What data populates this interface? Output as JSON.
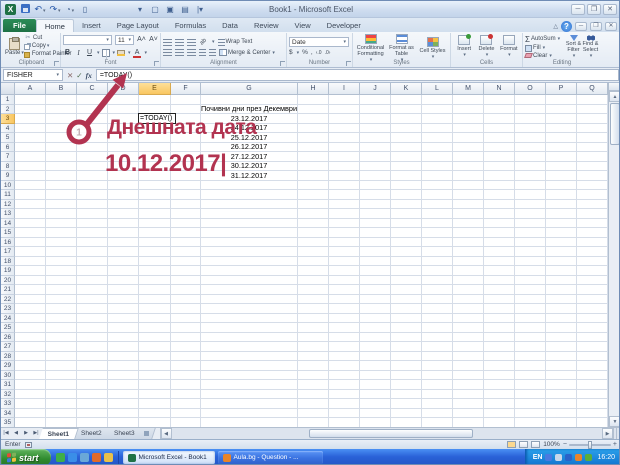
{
  "titlebar": {
    "title": "Book1 - Microsoft Excel"
  },
  "tabs": {
    "file": "File",
    "items": [
      "Home",
      "Insert",
      "Page Layout",
      "Formulas",
      "Data",
      "Review",
      "View",
      "Developer"
    ],
    "active": "Home"
  },
  "ribbon": {
    "clipboard": {
      "label": "Clipboard",
      "paste": "Paste",
      "cut": "Cut",
      "copy": "Copy",
      "format_painter": "Format Painter"
    },
    "font": {
      "label": "Font",
      "size": "11",
      "bold": "B",
      "italic": "I",
      "underline": "U"
    },
    "alignment": {
      "label": "Alignment",
      "wrap_text": "Wrap Text",
      "merge_center": "Merge & Center"
    },
    "number": {
      "label": "Number",
      "format": "Date",
      "percent": "%",
      "comma": ",",
      "currency": "$"
    },
    "styles": {
      "label": "Styles",
      "conditional": "Conditional Formatting",
      "format_table": "Format as Table",
      "cell_styles": "Cell Styles"
    },
    "cells": {
      "label": "Cells",
      "insert": "Insert",
      "delete": "Delete",
      "format": "Format"
    },
    "editing": {
      "label": "Editing",
      "autosum": "AutoSum",
      "fill": "Fill",
      "clear": "Clear",
      "sort_filter": "Sort & Filter",
      "find_select": "Find & Select"
    }
  },
  "formula_bar": {
    "name_box": "FISHER",
    "fx": "fx",
    "formula": "=TODAY()"
  },
  "spreadsheet": {
    "columns": [
      "A",
      "B",
      "C",
      "D",
      "E",
      "F",
      "G",
      "H",
      "I",
      "J",
      "K",
      "L",
      "M",
      "N",
      "O",
      "P",
      "Q"
    ],
    "row_count": 35,
    "active_column": "E",
    "active_row": 3,
    "active_cell": {
      "col": "E",
      "row": 3,
      "text": "=TODAY()"
    },
    "cells": [
      {
        "col": "G",
        "row": 2,
        "text": "Почивни дни през Декември"
      },
      {
        "col": "G",
        "row": 3,
        "text": "23.12.2017"
      },
      {
        "col": "G",
        "row": 4,
        "text": "24.12.2017"
      },
      {
        "col": "G",
        "row": 5,
        "text": "25.12.2017"
      },
      {
        "col": "G",
        "row": 6,
        "text": "26.12.2017"
      },
      {
        "col": "G",
        "row": 7,
        "text": "27.12.2017"
      },
      {
        "col": "G",
        "row": 8,
        "text": "30.12.2017"
      },
      {
        "col": "G",
        "row": 9,
        "text": "31.12.2017"
      }
    ]
  },
  "annotation": {
    "step_number": "1",
    "line1": "Днешната дата",
    "line2": "10.12.2017|",
    "color": "#b23350"
  },
  "sheet_bar": {
    "tabs": [
      "Sheet1",
      "Sheet2",
      "Sheet3"
    ],
    "active": "Sheet1"
  },
  "status_bar": {
    "mode": "Enter",
    "zoom": "100%"
  },
  "taskbar": {
    "start": "start",
    "quick_launch_icons": [
      {
        "name": "show-desktop-icon",
        "color": "#3fae49"
      },
      {
        "name": "internet-explorer-icon",
        "color": "#3a8ee8"
      },
      {
        "name": "browser-icon",
        "color": "#6aa8d8"
      },
      {
        "name": "firefox-icon",
        "color": "#e06a2a"
      },
      {
        "name": "folder-icon",
        "color": "#e8c04a"
      }
    ],
    "tasks": [
      {
        "label": "Microsoft Excel - Book1",
        "active": true,
        "icon_color": "#1e7145"
      },
      {
        "label": "Aula.bg - Question - ...",
        "active": false,
        "icon_color": "#e8842a"
      }
    ],
    "tray_language": "EN",
    "tray_icons": [
      {
        "name": "security-shield-icon",
        "color": "#4a7ae0"
      },
      {
        "name": "device-icon",
        "color": "#c8d8ea"
      },
      {
        "name": "bluetooth-icon",
        "color": "#2a62c8"
      },
      {
        "name": "antivirus-icon",
        "color": "#e8842a"
      },
      {
        "name": "messenger-icon",
        "color": "#5aae3a"
      }
    ],
    "time": "16:20"
  }
}
